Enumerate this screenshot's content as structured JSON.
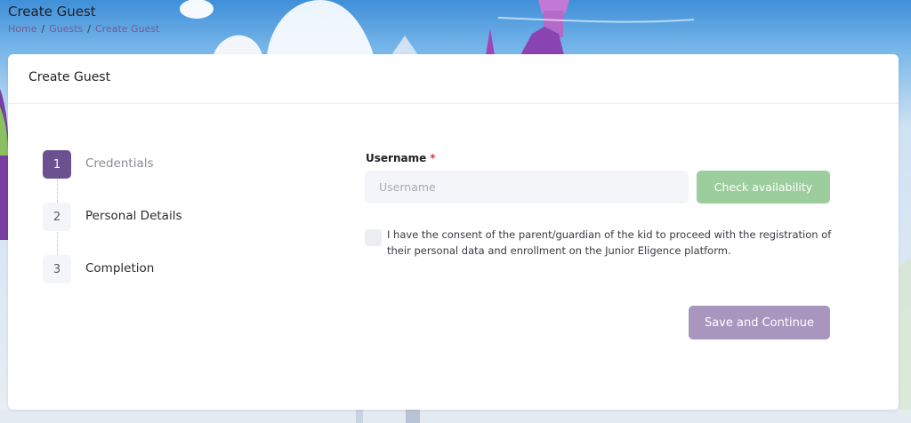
{
  "page": {
    "title": "Create Guest",
    "breadcrumb": [
      "Home",
      "Guests",
      "Create Guest"
    ],
    "breadcrumb_separator": "/"
  },
  "card": {
    "title": "Create Guest"
  },
  "stepper": {
    "active_step": 1,
    "steps": [
      {
        "number": "1",
        "label": "Credentials"
      },
      {
        "number": "2",
        "label": "Personal Details"
      },
      {
        "number": "3",
        "label": "Completion"
      }
    ]
  },
  "form": {
    "username_label": "Username",
    "required_marker": "*",
    "username_placeholder": "Username",
    "username_value": "",
    "check_availability_label": "Check availability",
    "consent_checked": false,
    "consent_text": "I have the consent of the parent/guardian of the kid to proceed with the registration of their personal data and enrollment on the Junior Eligence platform.",
    "save_label": "Save and Continue"
  },
  "colors": {
    "accent_purple": "#6b5190",
    "save_button": "#a896bf",
    "check_button": "#9ccd9c",
    "required": "#e3344f",
    "breadcrumb_link": "#7a5a93"
  }
}
